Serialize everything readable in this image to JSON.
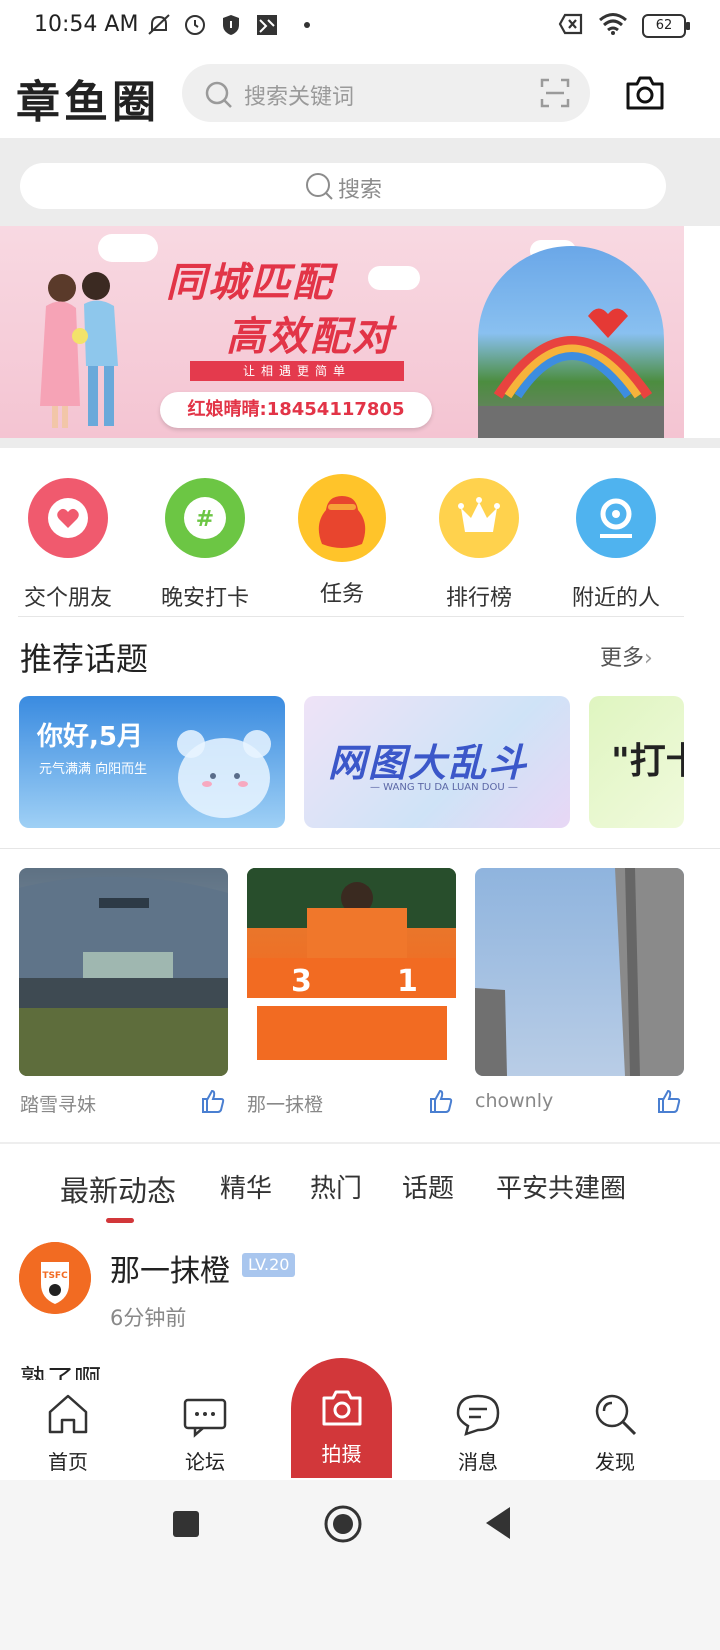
{
  "status_bar": {
    "time": "10:54 AM",
    "battery": "62"
  },
  "header": {
    "title": "章鱼圈",
    "search_placeholder": "搜索关键词"
  },
  "strip_search": {
    "placeholder": "搜索"
  },
  "banner": {
    "title_line1": "同城匹配",
    "title_line2": "高效配对",
    "subtitle": "让相遇更简单",
    "phone": "红娘晴晴:18454117805"
  },
  "quick_actions": [
    {
      "label": "交个朋友",
      "icon": "heart-icon",
      "color": "#f05a6e"
    },
    {
      "label": "晚安打卡",
      "icon": "hash-icon",
      "color": "#6cc644"
    },
    {
      "label": "任务",
      "icon": "red-bag-icon",
      "color": "#ffc42a"
    },
    {
      "label": "排行榜",
      "icon": "crown-icon",
      "color": "#ffd24d"
    },
    {
      "label": "附近的人",
      "icon": "location-icon",
      "color": "#4fb3ef"
    }
  ],
  "topics": {
    "title": "推荐话题",
    "more": "更多",
    "cards": [
      {
        "text": "你好,5月",
        "sub": "元气满满  向阳而生"
      },
      {
        "text": "网图大乱斗",
        "sub": "— WANG TU DA LUAN DOU —"
      },
      {
        "text": "\"打卡"
      }
    ]
  },
  "photo_posts": [
    {
      "author": "踏雪寻妹"
    },
    {
      "author": "那一抹橙"
    },
    {
      "author": "chownly"
    }
  ],
  "feed_tabs": [
    "最新动态",
    "精华",
    "热门",
    "话题",
    "平安共建圈"
  ],
  "feed_item": {
    "name": "那一抹橙",
    "level": "LV.20",
    "time": "6分钟前",
    "text": "熟了啊"
  },
  "bottom_nav": {
    "home": "首页",
    "forum": "论坛",
    "shoot": "拍摄",
    "messages": "消息",
    "discover": "发现"
  },
  "colors": {
    "accent": "#d2373a",
    "banner_red": "#e23447"
  }
}
